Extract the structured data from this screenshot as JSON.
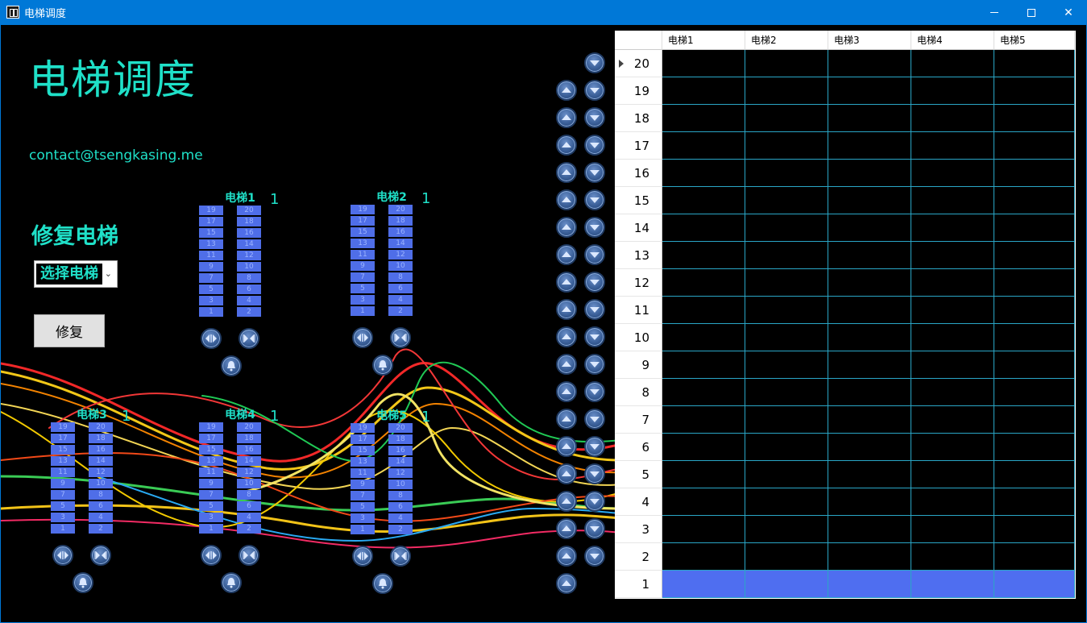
{
  "window": {
    "title": "电梯调度",
    "minimize": "—",
    "maximize": "□",
    "close": "✕"
  },
  "app": {
    "heading": "电梯调度",
    "contact": "contact@tsengkasing.me"
  },
  "repair": {
    "title": "修复电梯",
    "select_value": "选择电梯",
    "button_label": "修复"
  },
  "elevators": [
    {
      "name": "电梯1",
      "current_floor": "1"
    },
    {
      "name": "电梯2",
      "current_floor": "1"
    },
    {
      "name": "电梯3",
      "current_floor": "1"
    },
    {
      "name": "电梯4",
      "current_floor": "1"
    },
    {
      "name": "电梯5",
      "current_floor": "1"
    }
  ],
  "floor_buttons": {
    "left": [
      "19",
      "17",
      "15",
      "13",
      "11",
      "9",
      "7",
      "5",
      "3",
      "1"
    ],
    "right": [
      "20",
      "18",
      "16",
      "14",
      "12",
      "10",
      "8",
      "6",
      "4",
      "2"
    ]
  },
  "call_panel": {
    "up_floors": [
      "19",
      "18",
      "17",
      "16",
      "15",
      "14",
      "13",
      "12",
      "11",
      "10",
      "9",
      "8",
      "7",
      "6",
      "5",
      "4",
      "3",
      "2",
      "1"
    ],
    "down_floors": [
      "20",
      "19",
      "18",
      "17",
      "16",
      "15",
      "14",
      "13",
      "12",
      "11",
      "10",
      "9",
      "8",
      "7",
      "6",
      "5",
      "4",
      "3",
      "2"
    ]
  },
  "grid": {
    "columns": [
      "电梯1",
      "电梯2",
      "电梯3",
      "电梯4",
      "电梯5"
    ],
    "rows": [
      "20",
      "19",
      "18",
      "17",
      "16",
      "15",
      "14",
      "13",
      "12",
      "11",
      "10",
      "9",
      "8",
      "7",
      "6",
      "5",
      "4",
      "3",
      "2",
      "1"
    ],
    "active_row": "1",
    "active_color": "#4f6ef0",
    "line_color": "#2aa6c6"
  },
  "colors": {
    "accent": "#1fe0c8",
    "titlebar": "#0078d7",
    "floor_button": "#4f6ee8"
  }
}
